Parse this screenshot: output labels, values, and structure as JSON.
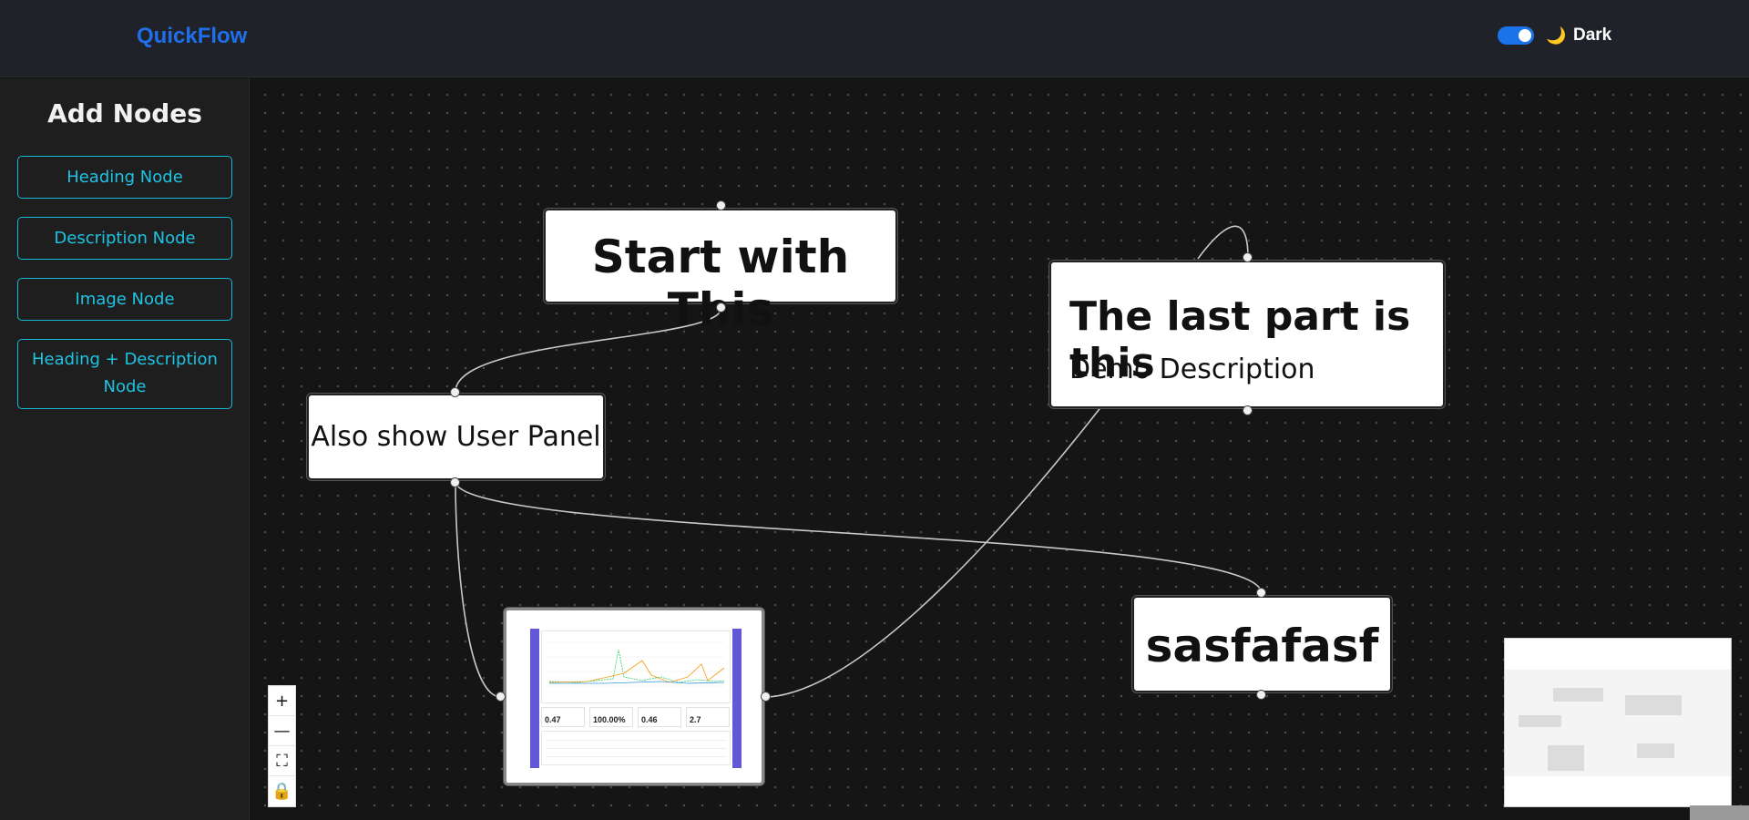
{
  "header": {
    "brand": "QuickFlow",
    "theme_toggle": {
      "on": true
    },
    "theme_icon": "moon-icon",
    "theme_label": "Dark"
  },
  "sidebar": {
    "title": "Add Nodes",
    "buttons": [
      {
        "label": "Heading Node"
      },
      {
        "label": "Description Node"
      },
      {
        "label": "Image Node"
      },
      {
        "label": "Heading + Description Node"
      }
    ]
  },
  "nodes": {
    "start": {
      "heading": "Start with This"
    },
    "user_panel": {
      "description": "Also show User Panel"
    },
    "last_part": {
      "heading": "The last part is this",
      "description": "Demo Description"
    },
    "sasfafasf": {
      "heading": "sasfafasf"
    },
    "image": {
      "kpis": [
        "0.47",
        "100.00%",
        "0.46",
        "2.7"
      ]
    }
  },
  "controls": [
    {
      "icon": "zoom-in-icon",
      "glyph": "+"
    },
    {
      "icon": "zoom-out-icon",
      "glyph": "—"
    },
    {
      "icon": "fit-view-icon",
      "glyph": "⛶"
    },
    {
      "icon": "lock-icon",
      "glyph": "🔒"
    }
  ],
  "colors": {
    "brand": "#1f6feb",
    "accent_cyan": "#1ec3e3",
    "toggle_on": "#1a73e8",
    "image_sidebar": "#6257d6"
  }
}
